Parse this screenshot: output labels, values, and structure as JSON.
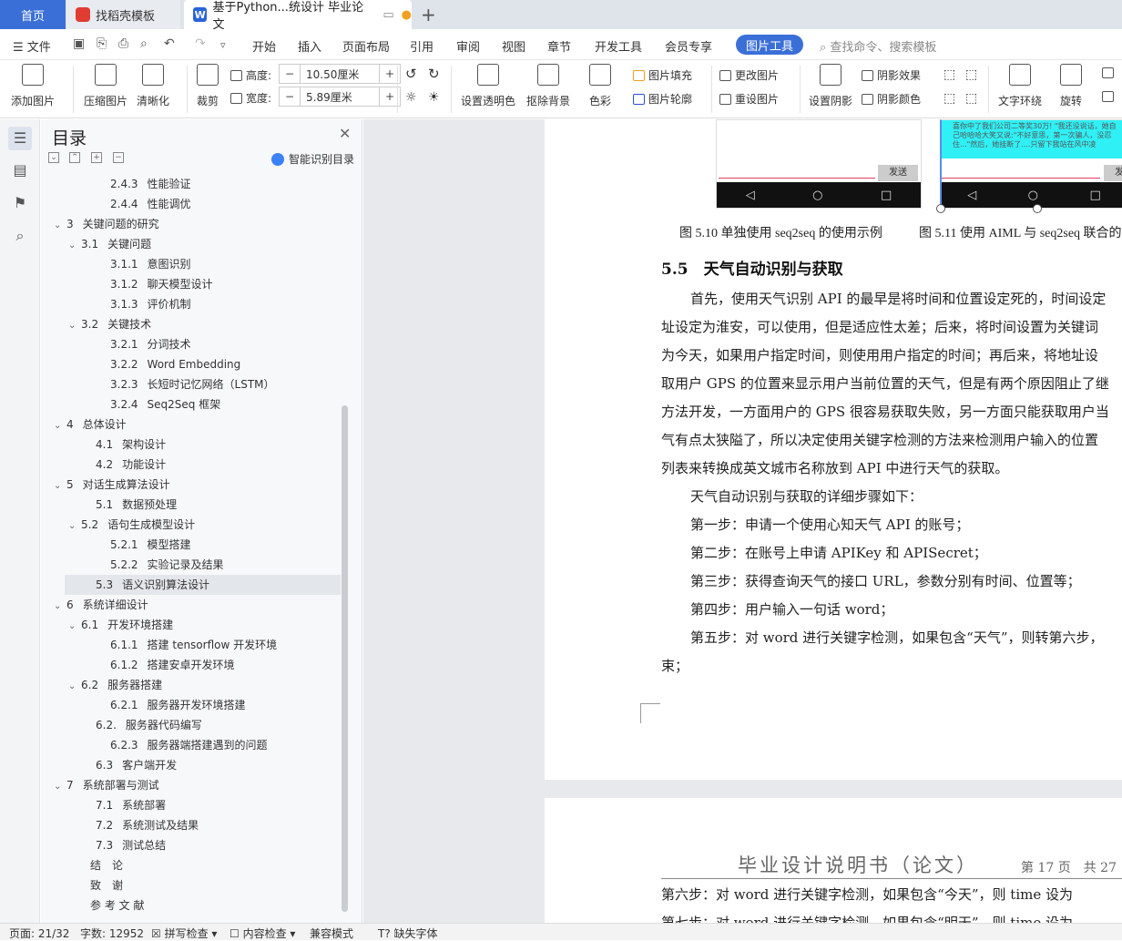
{
  "tabs": {
    "home": "首页",
    "draft": "找稻壳模板",
    "doc": "基于Python...统设计 毕业论文"
  },
  "menu": {
    "file": "文件",
    "items": [
      "开始",
      "插入",
      "页面布局",
      "引用",
      "审阅",
      "视图",
      "章节",
      "开发工具",
      "会员专享"
    ],
    "picture_tools": "图片工具",
    "search_placeholder": "查找命令、搜索模板"
  },
  "ribbon": {
    "add_picture": "添加图片",
    "compress": "压缩图片",
    "sharpen": "清晰化",
    "crop": "裁剪",
    "height_label": "高度:",
    "height_value": "10.50厘米",
    "width_label": "宽度:",
    "width_value": "5.89厘米",
    "transparent": "设置透明色",
    "remove_bg": "抠除背景",
    "color": "色彩",
    "fill": "图片填充",
    "outline": "图片轮廓",
    "change": "更改图片",
    "reset": "重设图片",
    "shadow_set": "设置阴影",
    "shadow_effect": "阴影效果",
    "shadow_color": "阴影颜色",
    "wrap": "文字环绕",
    "rotate": "旋转"
  },
  "toc": {
    "title": "目录",
    "smart": "智能识别目录",
    "items": [
      {
        "num": "2.4.3",
        "text": "性能验证"
      },
      {
        "num": "2.4.4",
        "text": "性能调优"
      },
      {
        "num": "3",
        "text": "关键问题的研究"
      },
      {
        "num": "3.1",
        "text": "关键问题"
      },
      {
        "num": "3.1.1",
        "text": "意图识别"
      },
      {
        "num": "3.1.2",
        "text": "聊天模型设计"
      },
      {
        "num": "3.1.3",
        "text": "评价机制"
      },
      {
        "num": "3.2",
        "text": "关键技术"
      },
      {
        "num": "3.2.1",
        "text": "分词技术"
      },
      {
        "num": "3.2.2",
        "text": "Word Embedding"
      },
      {
        "num": "3.2.3",
        "text": "长短时记忆网络（LSTM）"
      },
      {
        "num": "3.2.4",
        "text": "Seq2Seq 框架"
      },
      {
        "num": "4",
        "text": "总体设计"
      },
      {
        "num": "4.1",
        "text": "架构设计"
      },
      {
        "num": "4.2",
        "text": "功能设计"
      },
      {
        "num": "5",
        "text": "对话生成算法设计"
      },
      {
        "num": "5.1",
        "text": "数据预处理"
      },
      {
        "num": "5.2",
        "text": "语句生成模型设计"
      },
      {
        "num": "5.2.1",
        "text": "模型搭建"
      },
      {
        "num": "5.2.2",
        "text": "实验记录及结果"
      },
      {
        "num": "5.3",
        "text": "语义识别算法设计"
      },
      {
        "num": "6",
        "text": "系统详细设计"
      },
      {
        "num": "6.1",
        "text": "开发环境搭建"
      },
      {
        "num": "6.1.1",
        "text": "搭建 tensorflow 开发环境"
      },
      {
        "num": "6.1.2",
        "text": "搭建安卓开发环境"
      },
      {
        "num": "6.2",
        "text": "服务器搭建"
      },
      {
        "num": "6.2.1",
        "text": "服务器开发环境搭建"
      },
      {
        "num": "6.2.",
        "text": "服务器代码编写"
      },
      {
        "num": "6.2.3",
        "text": "服务器端搭建遇到的问题"
      },
      {
        "num": "6.3",
        "text": "客户端开发"
      },
      {
        "num": "7",
        "text": "系统部署与测试"
      },
      {
        "num": "7.1",
        "text": "系统部署"
      },
      {
        "num": "7.2",
        "text": "系统测试及结果"
      },
      {
        "num": "7.3",
        "text": "测试总结"
      },
      {
        "num": "",
        "text": "结　论"
      },
      {
        "num": "",
        "text": "致　谢"
      },
      {
        "num": "",
        "text": "参 考 文 献"
      }
    ]
  },
  "document": {
    "phone_send": "发送",
    "phone_chat": "喜你中了我们公司二等奖30万! \"我还没说话，她自己哈哈哈大笑又说:\"不好意思，第一次骗人，没忍住...\"然后，她挂断了....只留下我站在风中凌",
    "caption_510": "图 5.10  单独使用 seq2seq 的使用示例",
    "caption_511": "图 5.11  使用 AIML 与 seq2seq 联合的",
    "heading": "5.5　天气自动识别与获取",
    "paragraphs": [
      "首先，使用天气识别 API 的最早是将时间和位置设定死的，时间设定",
      "址设定为淮安，可以使用，但是适应性太差；后来，将时间设置为关键词",
      "为今天，如果用户指定时间，则使用用户指定的时间；再后来，将地址设",
      "取用户 GPS 的位置来显示用户当前位置的天气，但是有两个原因阻止了继",
      "方法开发，一方面用户的 GPS 很容易获取失败，另一方面只能获取用户当",
      "气有点太狭隘了，所以决定使用关键字检测的方法来检测用户输入的位置",
      "列表来转换成英文城市名称放到 API 中进行天气的获取。",
      "天气自动识别与获取的详细步骤如下：",
      "第一步：申请一个使用心知天气 API 的账号；",
      "第二步：在账号上申请 APIKey 和 APISecret；",
      "第三步：获得查询天气的接口 URL，参数分别有时间、位置等；",
      "第四步：用户输入一句话 word；",
      "第五步：对 word 进行关键字检测，如果包含“天气”，则转第六步，",
      "束；"
    ],
    "page2_header": "毕业设计说明书（论文）",
    "page2_pageinfo": "第 17 页　共 27",
    "page2_lines": [
      "第六步：对 word 进行关键字检测，如果包含“今天”，则 time 设为",
      "第七步：对 word 进行关键字检测，如果包含“明天”，则 time 设为"
    ]
  },
  "status": {
    "page": "页面: 21/32",
    "words": "字数: 12952",
    "spell": "拼写检查",
    "content": "内容检查",
    "compat": "兼容模式",
    "missing_font": "缺失字体"
  },
  "colors": {
    "accent": "#3b6fd8",
    "chat_bg": "#2ff0f5"
  }
}
